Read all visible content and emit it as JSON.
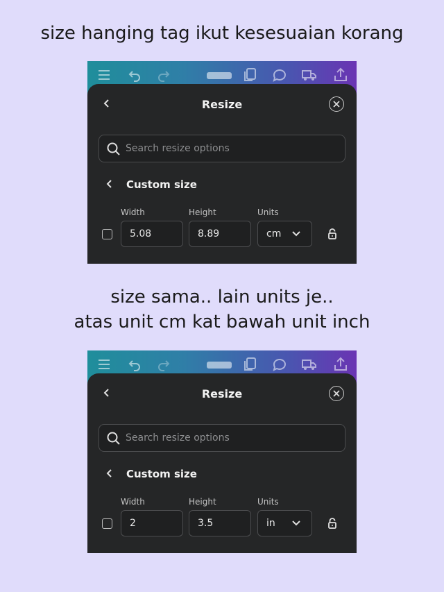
{
  "captions": {
    "line1": "size hanging tag ikut kesesuaian korang",
    "line2": "size sama.. lain units je..",
    "line3": "atas unit cm kat bawah unit inch"
  },
  "colors": {
    "background": "#e0dcfb",
    "panel": "#252627",
    "topbar_gradient_start": "#1f8e9b",
    "topbar_gradient_end": "#6a34b3"
  },
  "top_icons": [
    "menu-icon",
    "undo-icon",
    "redo-icon",
    "pages-icon",
    "copy-icon",
    "comment-icon",
    "truck-icon",
    "share-icon"
  ],
  "screenshots": [
    {
      "panel_title": "Resize",
      "search_placeholder": "Search resize options",
      "custom_size_label": "Custom size",
      "width_label": "Width",
      "height_label": "Height",
      "units_label": "Units",
      "width_value": "5.08",
      "height_value": "8.89",
      "units_value": "cm"
    },
    {
      "panel_title": "Resize",
      "search_placeholder": "Search resize options",
      "custom_size_label": "Custom size",
      "width_label": "Width",
      "height_label": "Height",
      "units_label": "Units",
      "width_value": "2",
      "height_value": "3.5",
      "units_value": "in"
    }
  ]
}
